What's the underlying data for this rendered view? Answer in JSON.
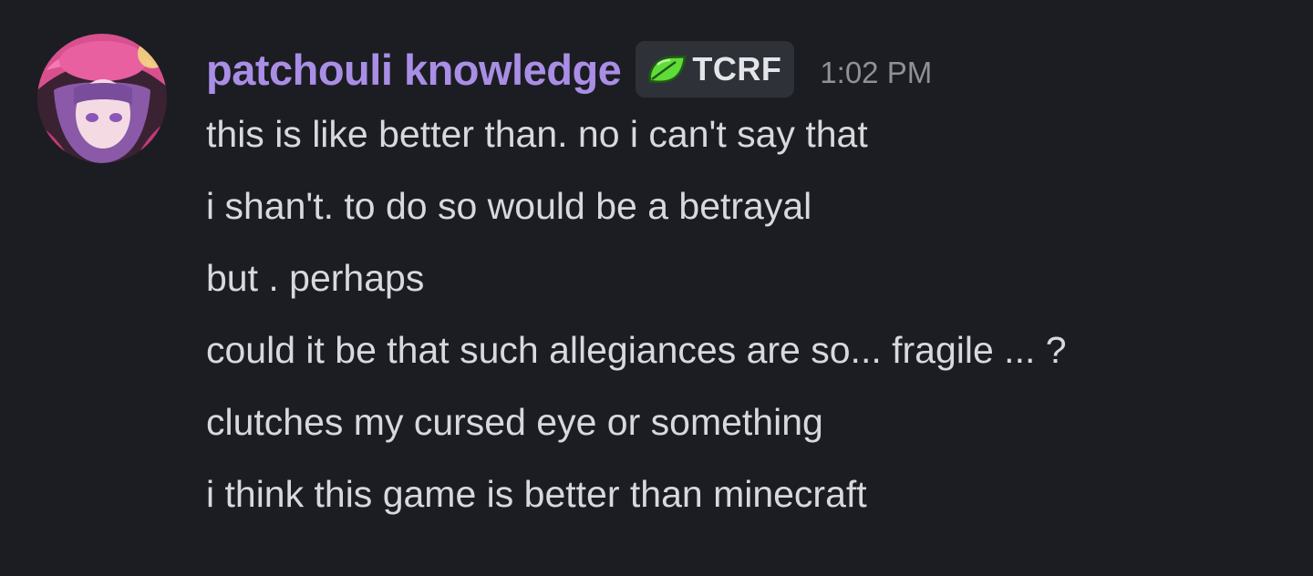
{
  "message": {
    "author": "patchouli knowledge",
    "tag": {
      "icon": "leaf-icon",
      "label": "TCRF"
    },
    "timestamp": "1:02 PM",
    "lines": [
      "this is like better than. no i can't say that",
      "i shan't. to do so would be a betrayal",
      "but . perhaps",
      "could it be that such allegiances are so... fragile ... ?",
      "clutches my cursed eye or something",
      "i think this game is better than minecraft"
    ]
  },
  "colors": {
    "background": "#1c1d22",
    "username": "#a98ee6",
    "tag_background": "#2f3138",
    "leaf": "#5fdc3a",
    "timestamp": "#8e9199",
    "text": "#d7d9dd"
  }
}
